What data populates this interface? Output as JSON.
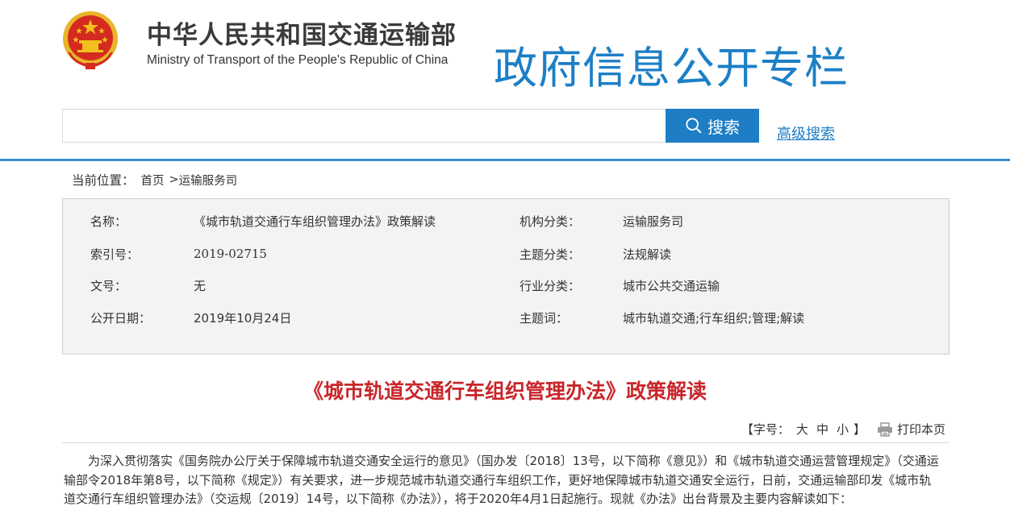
{
  "header": {
    "ministry_name_cn": "中华人民共和国交通运输部",
    "ministry_name_en": "Ministry of Transport of the People's Republic of China",
    "column_title": "政府信息公开专栏"
  },
  "search": {
    "value": "",
    "placeholder": "",
    "button_label": "搜索",
    "advanced_label": "高级搜索"
  },
  "breadcrumb": {
    "label": "当前位置：",
    "home": "首页",
    "separator": ">",
    "current": "运输服务司"
  },
  "info": {
    "name_label": "名称：",
    "name_value": "《城市轨道交通行车组织管理办法》政策解读",
    "index_label": "索引号：",
    "index_value": "2019-02715",
    "docno_label": "文号：",
    "docno_value": "无",
    "date_label": "公开日期：",
    "date_value": "2019年10月24日",
    "org_label": "机构分类：",
    "org_value": "运输服务司",
    "topic_label": "主题分类：",
    "topic_value": "法规解读",
    "industry_label": "行业分类：",
    "industry_value": "城市公共交通运输",
    "keywords_label": "主题词：",
    "keywords_value": "城市轨道交通;行车组织;管理;解读"
  },
  "article": {
    "title": "《城市轨道交通行车组织管理办法》政策解读",
    "font_size_open": "【字号：",
    "font_size_large": "大",
    "font_size_medium": "中",
    "font_size_small": "小",
    "font_size_close": "】",
    "print_label": "打印本页",
    "paragraph_1": "为深入贯彻落实《国务院办公厅关于保障城市轨道交通安全运行的意见》（国办发〔2018〕13号，以下简称《意见》）和《城市轨道交通运营管理规定》（交通运输部令2018年第8号，以下简称《规定》）有关要求，进一步规范城市轨道交通行车组织工作，更好地保障城市轨道交通安全运行，日前，交通运输部印发《城市轨道交通行车组织管理办法》（交运规〔2019〕14号，以下简称《办法》），将于2020年4月1日起施行。现就《办法》出台背景及主要内容解读如下："
  },
  "colors": {
    "accent_blue": "#1d7dc5",
    "title_red": "#c8262b",
    "emblem_red": "#d42a1f",
    "emblem_gold": "#f2c01e"
  }
}
